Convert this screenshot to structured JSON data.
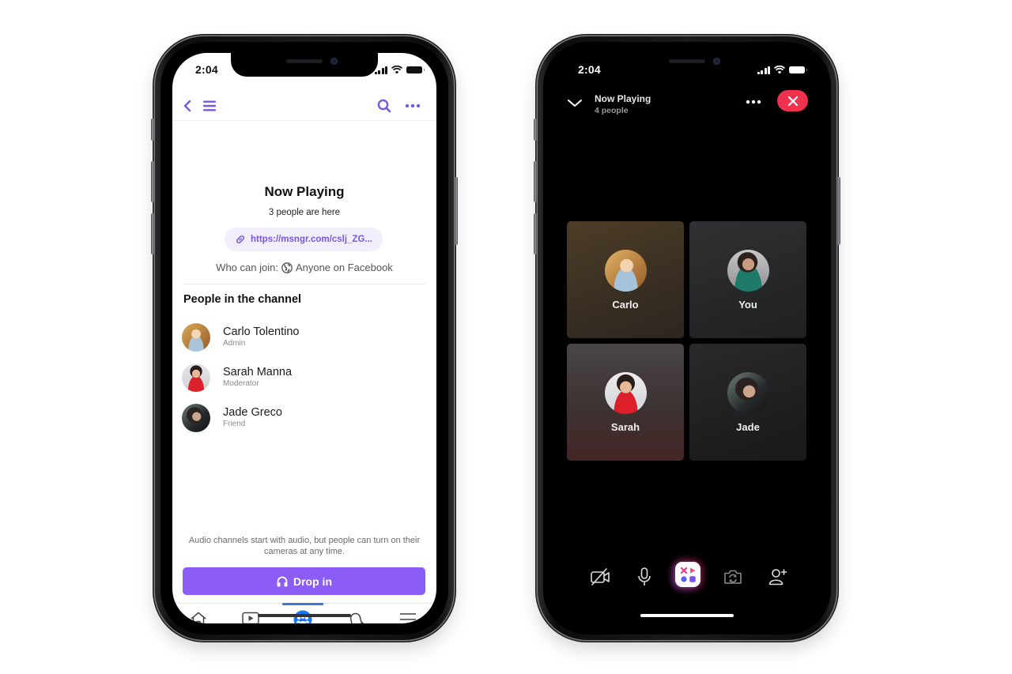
{
  "left_phone": {
    "status_bar": {
      "time": "2:04"
    },
    "top_nav": {
      "back_icon": "chevron-left-icon",
      "menu_icon": "hamburger-icon",
      "search_icon": "search-icon",
      "more_icon": "more-horizontal-icon"
    },
    "room": {
      "title": "Now Playing",
      "subtitle": "3 people are here",
      "link": "https://msngr.com/cslj_ZG...",
      "who_can_join_label": "Who can join:",
      "who_can_join_value": "Anyone on Facebook"
    },
    "people_section": {
      "heading": "People in the channel",
      "people": [
        {
          "name": "Carlo Tolentino",
          "role": "Admin"
        },
        {
          "name": "Sarah Manna",
          "role": "Moderator"
        },
        {
          "name": "Jade Greco",
          "role": "Friend"
        }
      ]
    },
    "note": "Audio channels start with audio, but people can turn on their cameras at any time.",
    "drop_in_label": "Drop in",
    "tab_bar": {
      "active_index": 2,
      "tabs": [
        "home",
        "watch",
        "groups",
        "notifications",
        "menu"
      ]
    },
    "colors": {
      "accent": "#8b5cf6",
      "icon_purple": "#7b57e0",
      "tab_active": "#3b74d6"
    }
  },
  "right_phone": {
    "status_bar": {
      "time": "2:04"
    },
    "header": {
      "title": "Now Playing",
      "subtitle": "4 people"
    },
    "participants": [
      {
        "name": "Carlo"
      },
      {
        "name": "You"
      },
      {
        "name": "Sarah"
      },
      {
        "name": "Jade"
      }
    ],
    "controls": [
      "camera-off",
      "microphone",
      "activities",
      "flip-camera",
      "add-person"
    ],
    "colors": {
      "end_call": "#f0314e",
      "background": "#000000"
    }
  }
}
